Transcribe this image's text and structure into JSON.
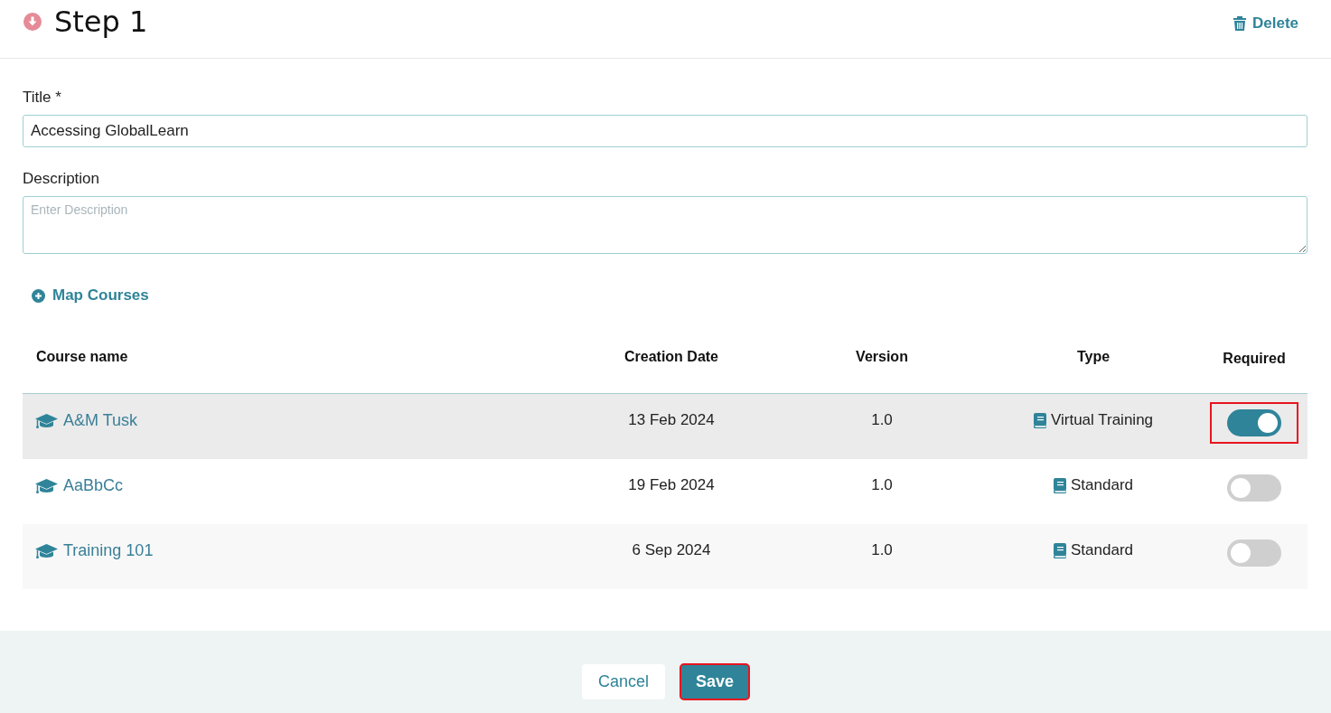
{
  "header": {
    "title": "Step 1",
    "delete_label": "Delete"
  },
  "form": {
    "title_label": "Title *",
    "title_value": "Accessing GlobalLearn",
    "description_label": "Description",
    "description_placeholder": "Enter Description"
  },
  "map_courses": "Map Courses",
  "table": {
    "columns": [
      "Course name",
      "Creation Date",
      "Version",
      "Type",
      "Required"
    ],
    "rows": [
      {
        "name": "A&M Tusk",
        "date": "13 Feb 2024",
        "version": "1.0",
        "type": "Virtual Training",
        "required": true,
        "hovered": true,
        "highlighted": true
      },
      {
        "name": "AaBbCc",
        "date": "19 Feb 2024",
        "version": "1.0",
        "type": "Standard",
        "required": false,
        "hovered": false,
        "highlighted": false
      },
      {
        "name": "Training 101",
        "date": "6 Sep 2024",
        "version": "1.0",
        "type": "Standard",
        "required": false,
        "hovered": false,
        "highlighted": false
      }
    ]
  },
  "footer": {
    "buttons": [
      {
        "kind": "secondary",
        "label": "Cancel",
        "highlighted": false
      },
      {
        "kind": "primary",
        "label": "Save",
        "highlighted": true
      }
    ]
  }
}
